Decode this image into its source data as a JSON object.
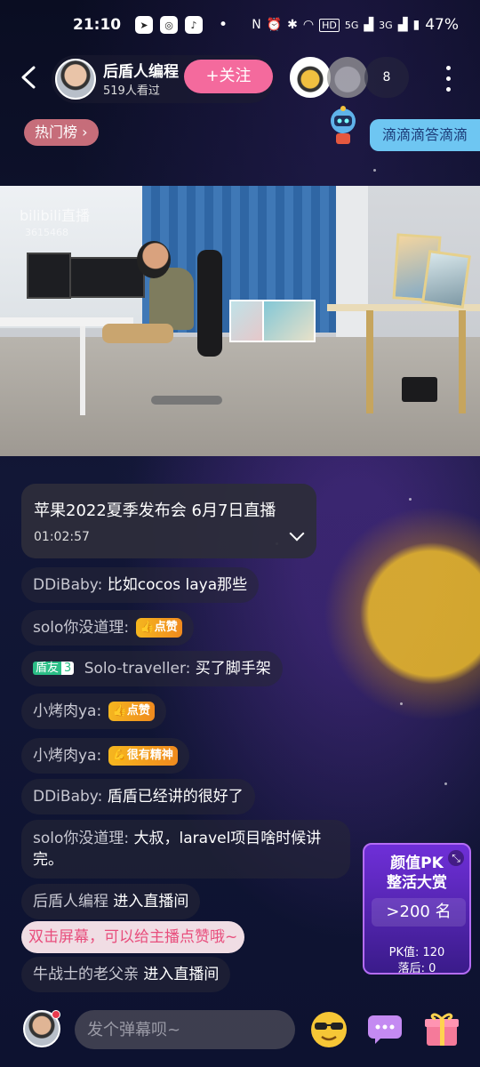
{
  "status_bar": {
    "time": "21:10",
    "apps": [
      "➤",
      "◎",
      "♪"
    ],
    "network_labels": [
      "HD",
      "5G",
      "3G"
    ],
    "battery": "47%"
  },
  "header": {
    "host_name": "后盾人编程",
    "viewers": "519人看过",
    "follow_label": "+关注",
    "online_count": "8"
  },
  "hot_rank": {
    "label": "热门榜 ›"
  },
  "promo": {
    "label": "滴滴滴答滴滴"
  },
  "video": {
    "watermark": "bilibili直播",
    "room_id": "3615468"
  },
  "replay": {
    "title": "苹果2022夏季发布会 6月7日直播",
    "time": "01:02:57"
  },
  "chat": {
    "messages": [
      {
        "user": "DDiBaby:",
        "text": "比如cocos laya那些"
      },
      {
        "user": "solo你没道理:",
        "badge": "点赞"
      },
      {
        "fan_name": "盾友",
        "fan_level": "3",
        "user": "Solo-traveller:",
        "text": "买了脚手架"
      },
      {
        "user": "小烤肉ya:",
        "badge": "点赞"
      },
      {
        "user": "小烤肉ya:",
        "badge": "很有精神"
      },
      {
        "user": "DDiBaby:",
        "text": "盾盾已经讲的很好了"
      },
      {
        "user": "solo你没道理:",
        "text": "大叔，laravel项目啥时候讲完。"
      },
      {
        "user": "后盾人编程",
        "text": "进入直播间"
      },
      {
        "user": "牛战士的老父亲",
        "text": "进入直播间"
      }
    ],
    "tip": "双击屏幕，可以给主播点赞哦~"
  },
  "pk": {
    "title_line1": "颜值PK",
    "title_line2": "整活大赏",
    "close": "⤡",
    "rank": ">200 名",
    "score": "PK值: 120",
    "behind": "落后: 0"
  },
  "bottom": {
    "input_placeholder": "发个弹幕呗~"
  },
  "colors": {
    "follow": "#f46a9d",
    "hot_rank": "#c66d7a",
    "promo": "#6ec6f2",
    "tip": "#e84e7d",
    "pk": "#6f2fd8"
  }
}
